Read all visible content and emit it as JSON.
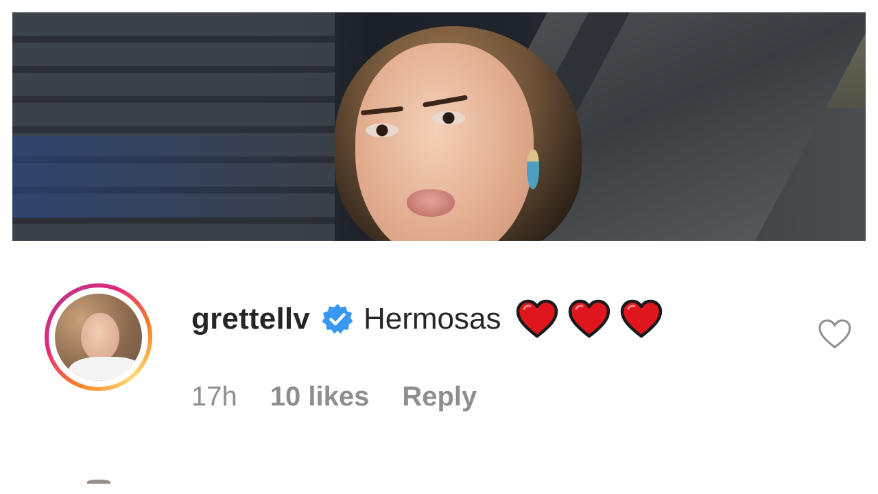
{
  "comment": {
    "username": "grettellv",
    "verified": true,
    "text": "Hermosas",
    "emoji": [
      "red-heart",
      "red-heart",
      "red-heart"
    ],
    "time": "17h",
    "likes": "10 likes",
    "reply_label": "Reply",
    "liked": false
  },
  "colors": {
    "text": "#262626",
    "muted": "#8e8e8e",
    "verified_badge": "#3897f0",
    "heart_emoji": "#e0161e",
    "story_ring": [
      "#f58529",
      "#dd2a7b",
      "#c13584",
      "#feda77"
    ]
  },
  "icons": {
    "verified": "verified-badge-icon",
    "like": "heart-outline-icon",
    "emoji": "red-heart-emoji"
  }
}
